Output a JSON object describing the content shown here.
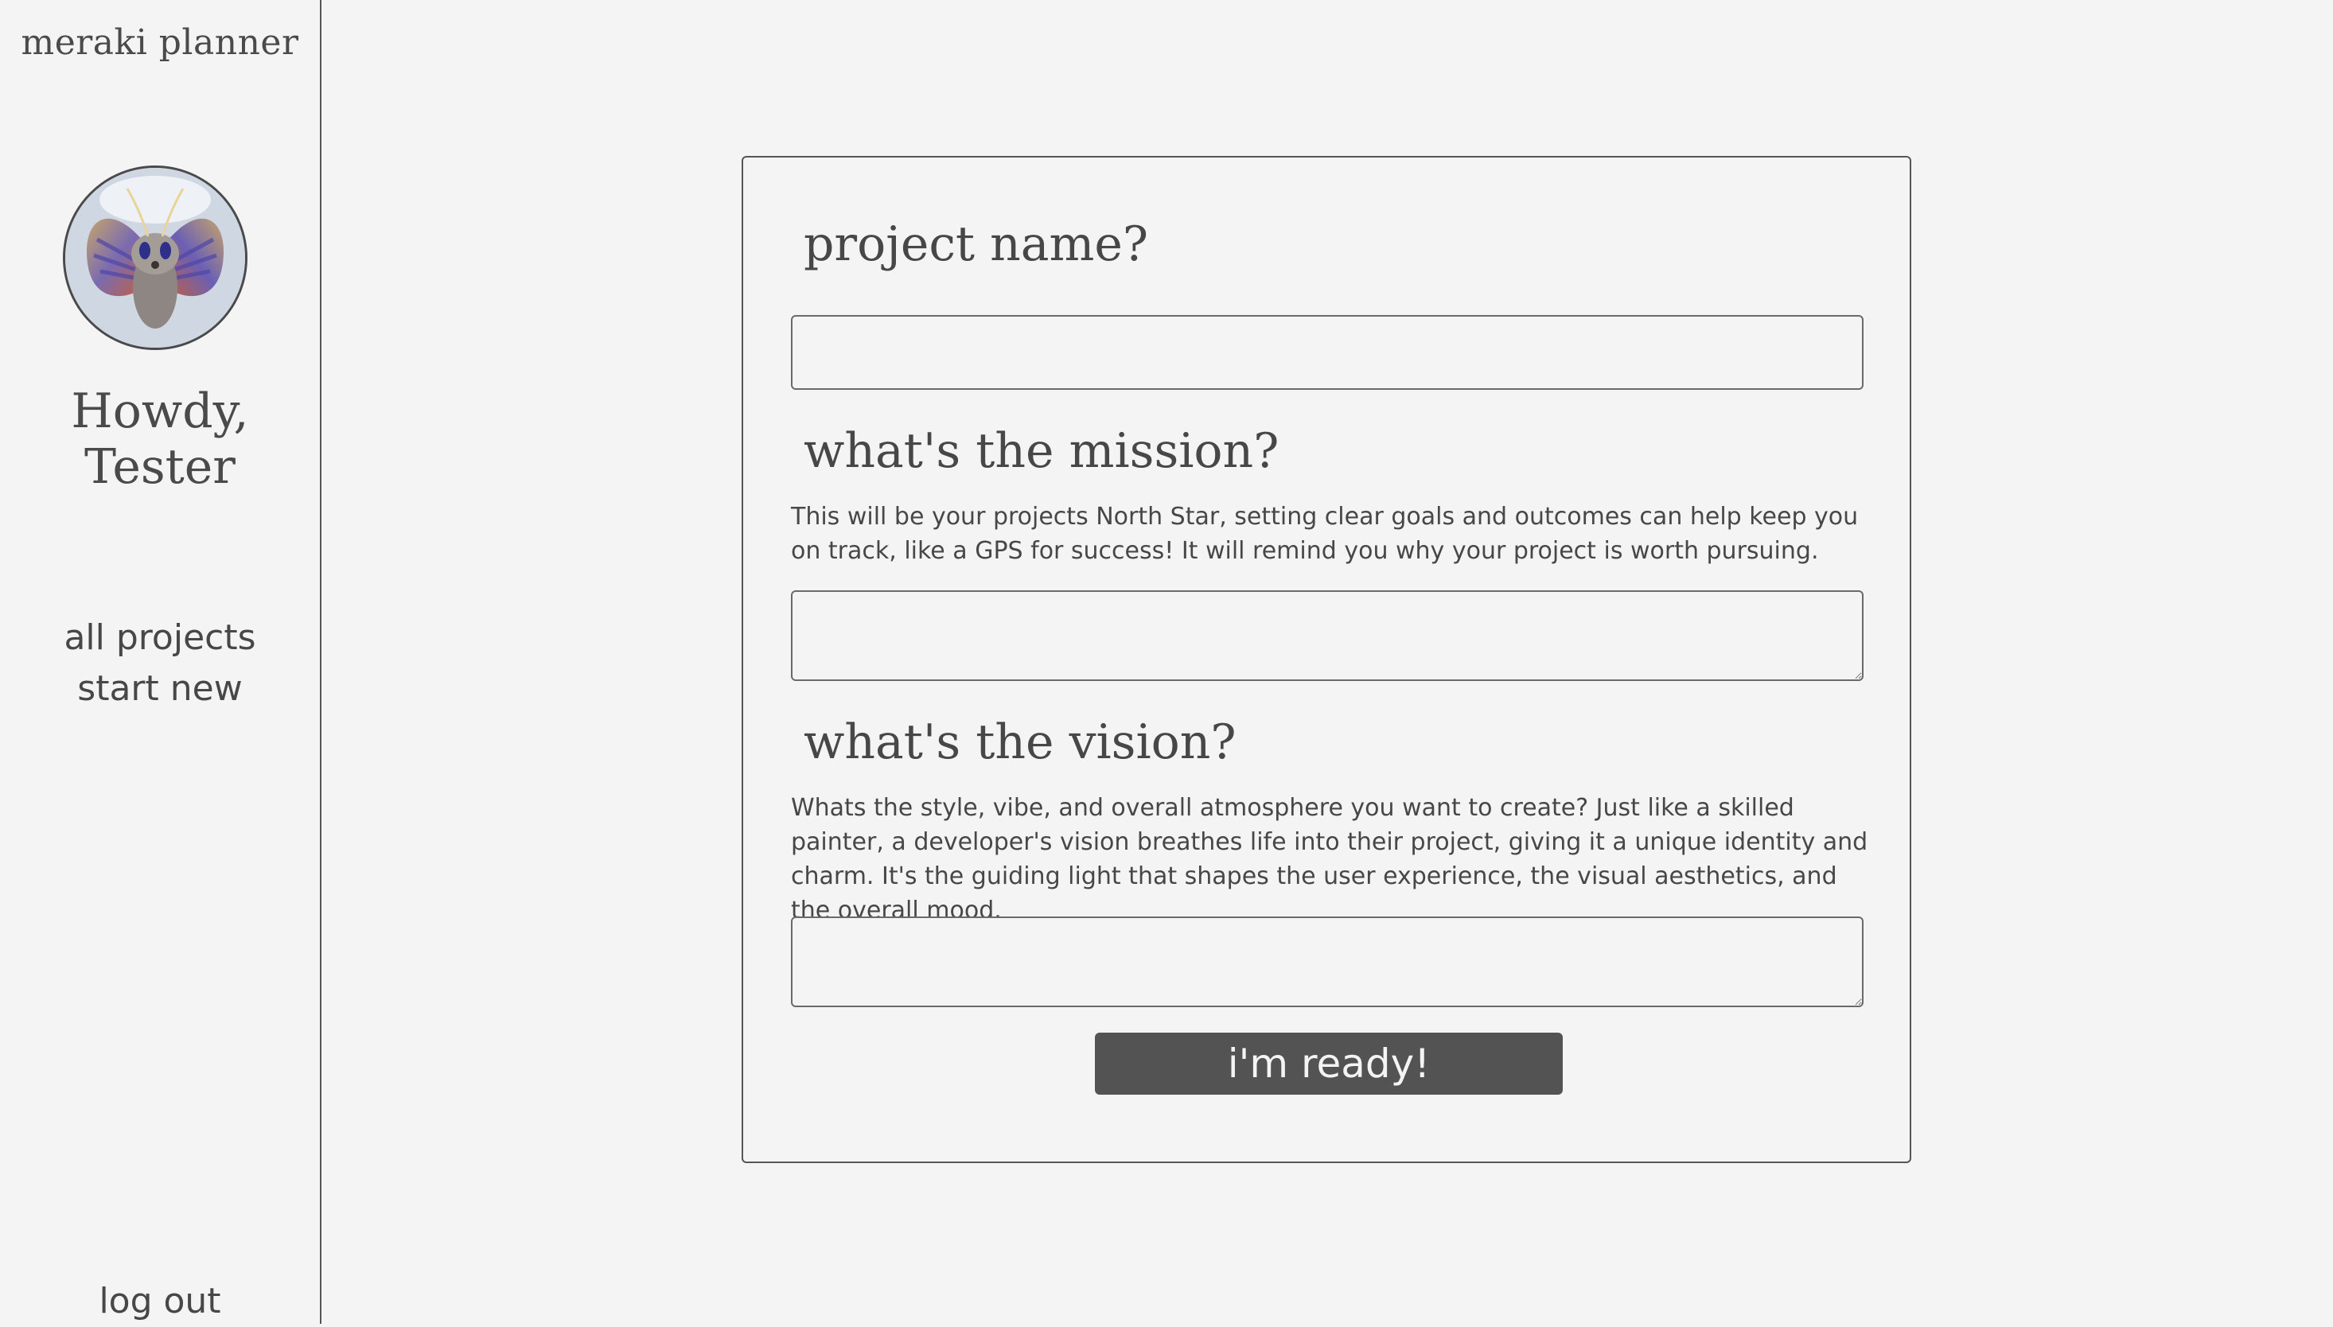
{
  "sidebar": {
    "app_title": "meraki planner",
    "greeting": "Howdy, Tester",
    "avatar_icon": "moth-avatar",
    "nav": [
      {
        "label": "all projects"
      },
      {
        "label": "start new"
      }
    ],
    "logout_label": "log out"
  },
  "form": {
    "project_name_heading": "project name?",
    "project_name_value": "",
    "mission_heading": "what's the mission?",
    "mission_description": "This will be your projects North Star, setting clear goals and outcomes can help keep you on track, like a GPS for success! It will remind you why your project is worth pursuing.",
    "mission_value": "",
    "vision_heading": "what's the vision?",
    "vision_description": "Whats the style, vibe, and overall atmosphere you want to create? Just like a skilled painter, a developer's vision breathes life into their project, giving it a unique identity and charm. It's the guiding light that shapes the user experience, the visual aesthetics, and the overall mood.",
    "vision_value": "",
    "submit_label": "i'm ready!"
  },
  "colors": {
    "background": "#f4f4f4",
    "text": "#474747",
    "border": "#555555",
    "button": "#535353",
    "button_text": "#f4f4f4"
  }
}
